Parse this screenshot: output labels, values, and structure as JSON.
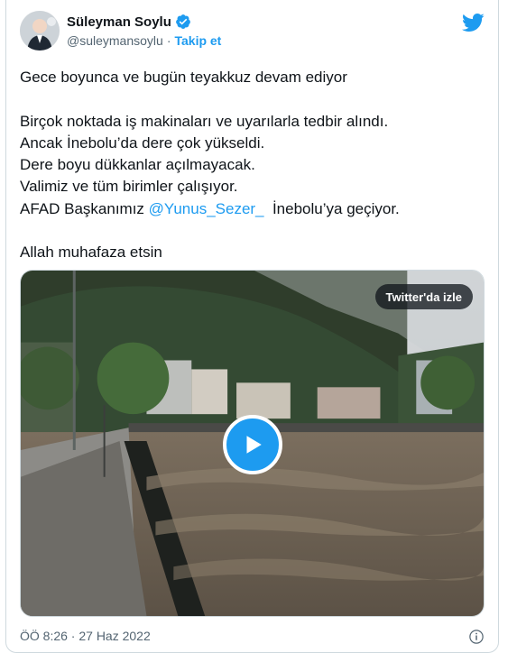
{
  "tweet": {
    "author_name": "Süleyman Soylu",
    "handle": "@suleymansoylu",
    "separator": "·",
    "follow_label": "Takip et",
    "lines": {
      "l1": "Gece boyunca ve bugün teyakkuz devam ediyor",
      "l2": "Birçok noktada iş makinaları ve uyarılarla tedbir alındı.",
      "l3": "Ancak İnebolu’da dere çok yükseldi.",
      "l4": "Dere boyu dükkanlar açılmayacak.",
      "l5": "Valimiz ve tüm birimler çalışıyor.",
      "l6_prefix": "AFAD Başkanımız ",
      "l6_mention": "@Yunus_Sezer_",
      "l6_suffix": "  İnebolu’ya geçiyor.",
      "l7": "Allah muhafaza etsin"
    },
    "video": {
      "watch_label": "Twitter'da izle",
      "play_icon": "play-icon"
    },
    "timestamp": "ÖÖ 8:26 · 27 Haz 2022"
  },
  "colors": {
    "accent": "#1d9bf0",
    "text": "#0f1419",
    "muted": "#536471"
  }
}
